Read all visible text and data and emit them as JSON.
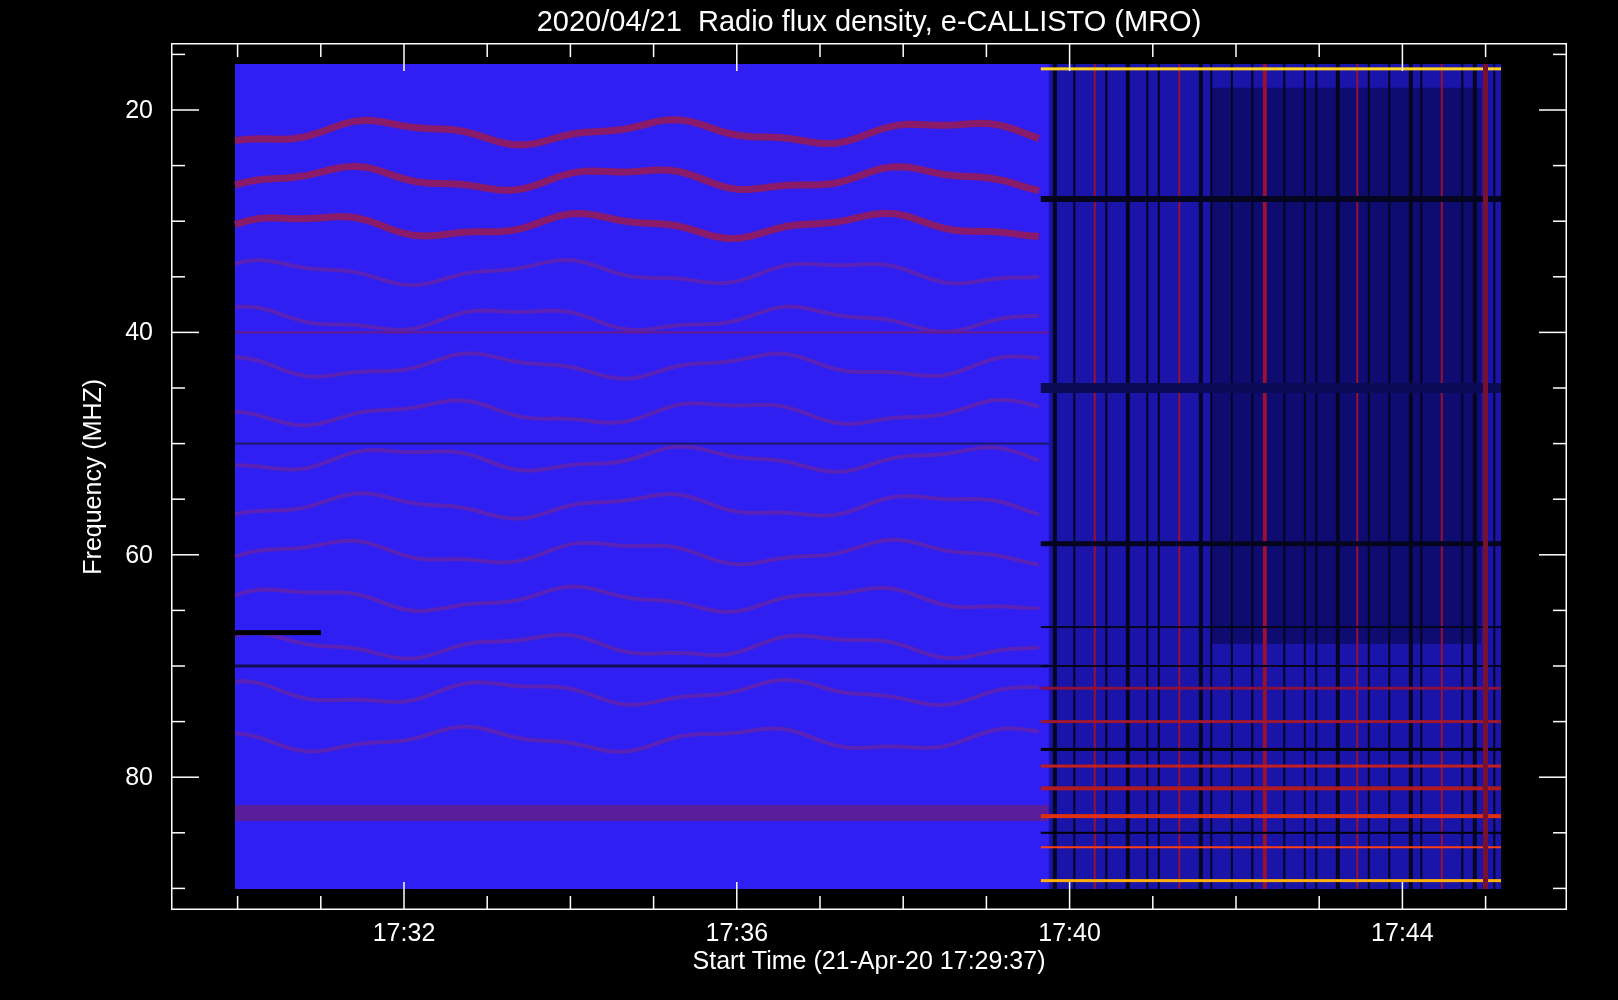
{
  "title": "2020/04/21  Radio flux density, e-CALLISTO (MRO)",
  "ylabel": "Frequency (MHZ)",
  "xlabel": "Start Time (21-Apr-20 17:29:37)",
  "yticks": [
    "20",
    "40",
    "60",
    "80"
  ],
  "xticks": [
    "17:32",
    "17:36",
    "17:40",
    "17:44"
  ]
}
